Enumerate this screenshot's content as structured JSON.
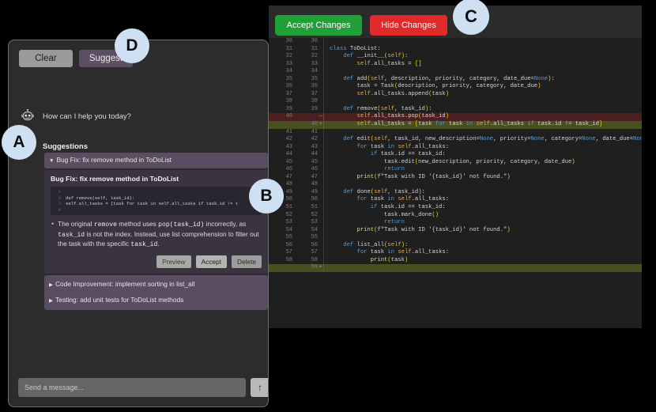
{
  "chat": {
    "toolbar": {
      "clear_label": "Clear",
      "suggest_label": "Suggest"
    },
    "greeting": "How can I help you today?",
    "suggestions_label": "Suggestions",
    "suggestions": [
      {
        "caret": "▼",
        "header": "Bug Fix: fix remove method in ToDoList",
        "expanded": true,
        "card_title": "Bug Fix: fix remove method in ToDoList",
        "snippet": [
          {
            "num": "1",
            "code": ""
          },
          {
            "num": "2",
            "code": "def remove(self, task_id):"
          },
          {
            "num": "3",
            "code": "    self.all_tasks = [task for task in self.all_tasks if task.id != t"
          },
          {
            "num": "4",
            "code": ""
          }
        ],
        "bullet_parts": [
          "The original ",
          "remove",
          " method uses ",
          "pop(task_id)",
          " incorrectly, as ",
          "task_id",
          " is not the index. Instead, use list comprehension to filter out the task with the specific ",
          "task_id",
          "."
        ],
        "actions": {
          "preview": "Preview",
          "accept": "Accept",
          "delete": "Delete"
        }
      },
      {
        "caret": "▶",
        "header": "Code Improvement: implement sorting in list_all",
        "expanded": false
      },
      {
        "caret": "▶",
        "header": "Testing: add unit tests for ToDoList methods",
        "expanded": false
      }
    ],
    "input": {
      "placeholder": "Send a message...",
      "value": "",
      "send_icon": "↑"
    }
  },
  "editor": {
    "toolbar": {
      "accept_label": "Accept Changes",
      "hide_label": "Hide Changes"
    },
    "accent_accept": "#21a038",
    "accent_hide": "#e12a2a",
    "lines": [
      {
        "old": "30",
        "new": "30",
        "mark": "",
        "type": "ctx",
        "code": ""
      },
      {
        "old": "31",
        "new": "31",
        "mark": "",
        "type": "ctx",
        "code": "class ToDoList:"
      },
      {
        "old": "32",
        "new": "32",
        "mark": "",
        "type": "ctx",
        "code": "    def __init__(self):"
      },
      {
        "old": "33",
        "new": "33",
        "mark": "",
        "type": "ctx",
        "code": "        self.all_tasks = []"
      },
      {
        "old": "34",
        "new": "34",
        "mark": "",
        "type": "ctx",
        "code": ""
      },
      {
        "old": "35",
        "new": "35",
        "mark": "",
        "type": "ctx",
        "code": "    def add(self, description, priority, category, date_due=None):"
      },
      {
        "old": "36",
        "new": "36",
        "mark": "",
        "type": "ctx",
        "code": "        task = Task(description, priority, category, date_due)"
      },
      {
        "old": "37",
        "new": "37",
        "mark": "",
        "type": "ctx",
        "code": "        self.all_tasks.append(task)"
      },
      {
        "old": "38",
        "new": "38",
        "mark": "",
        "type": "ctx",
        "code": ""
      },
      {
        "old": "39",
        "new": "39",
        "mark": "",
        "type": "ctx",
        "code": "    def remove(self, task_id):"
      },
      {
        "old": "40",
        "new": "",
        "mark": "—",
        "type": "del",
        "code": "        self.all_tasks.pop(task_id)"
      },
      {
        "old": "",
        "new": "40",
        "mark": "+",
        "type": "add",
        "code": "        self.all_tasks = [task for task in self.all_tasks if task.id != task_id]"
      },
      {
        "old": "41",
        "new": "41",
        "mark": "",
        "type": "ctx",
        "code": ""
      },
      {
        "old": "42",
        "new": "42",
        "mark": "",
        "type": "ctx",
        "code": "    def edit(self, task_id, new_description=None, priority=None, category=None, date_due=None):"
      },
      {
        "old": "43",
        "new": "43",
        "mark": "",
        "type": "ctx",
        "code": "        for task in self.all_tasks:"
      },
      {
        "old": "44",
        "new": "44",
        "mark": "",
        "type": "ctx",
        "code": "            if task.id == task_id:"
      },
      {
        "old": "45",
        "new": "45",
        "mark": "",
        "type": "ctx",
        "code": "                task.edit(new_description, priority, category, date_due)"
      },
      {
        "old": "46",
        "new": "46",
        "mark": "",
        "type": "ctx",
        "code": "                return"
      },
      {
        "old": "47",
        "new": "47",
        "mark": "",
        "type": "ctx",
        "code": "        print(f\"Task with ID '{task_id}' not found.\")"
      },
      {
        "old": "48",
        "new": "48",
        "mark": "",
        "type": "ctx",
        "code": ""
      },
      {
        "old": "49",
        "new": "49",
        "mark": "",
        "type": "ctx",
        "code": "    def done(self, task_id):"
      },
      {
        "old": "50",
        "new": "50",
        "mark": "",
        "type": "ctx",
        "code": "        for task in self.all_tasks:"
      },
      {
        "old": "51",
        "new": "51",
        "mark": "",
        "type": "ctx",
        "code": "            if task.id == task_id:"
      },
      {
        "old": "52",
        "new": "52",
        "mark": "",
        "type": "ctx",
        "code": "                task.mark_done()"
      },
      {
        "old": "53",
        "new": "53",
        "mark": "",
        "type": "ctx",
        "code": "                return"
      },
      {
        "old": "54",
        "new": "54",
        "mark": "",
        "type": "ctx",
        "code": "        print(f\"Task with ID '{task_id}' not found.\")"
      },
      {
        "old": "55",
        "new": "55",
        "mark": "",
        "type": "ctx",
        "code": ""
      },
      {
        "old": "56",
        "new": "56",
        "mark": "",
        "type": "ctx",
        "code": "    def list_all(self):"
      },
      {
        "old": "57",
        "new": "57",
        "mark": "",
        "type": "ctx",
        "code": "        for task in self.all_tasks:"
      },
      {
        "old": "58",
        "new": "58",
        "mark": "",
        "type": "ctx",
        "code": "            print(task)"
      },
      {
        "old": "",
        "new": "59",
        "mark": "+",
        "type": "add",
        "code": ""
      }
    ]
  },
  "annotations": [
    {
      "id": "A",
      "label": "A"
    },
    {
      "id": "B",
      "label": "B"
    },
    {
      "id": "C",
      "label": "C"
    },
    {
      "id": "D",
      "label": "D"
    }
  ]
}
